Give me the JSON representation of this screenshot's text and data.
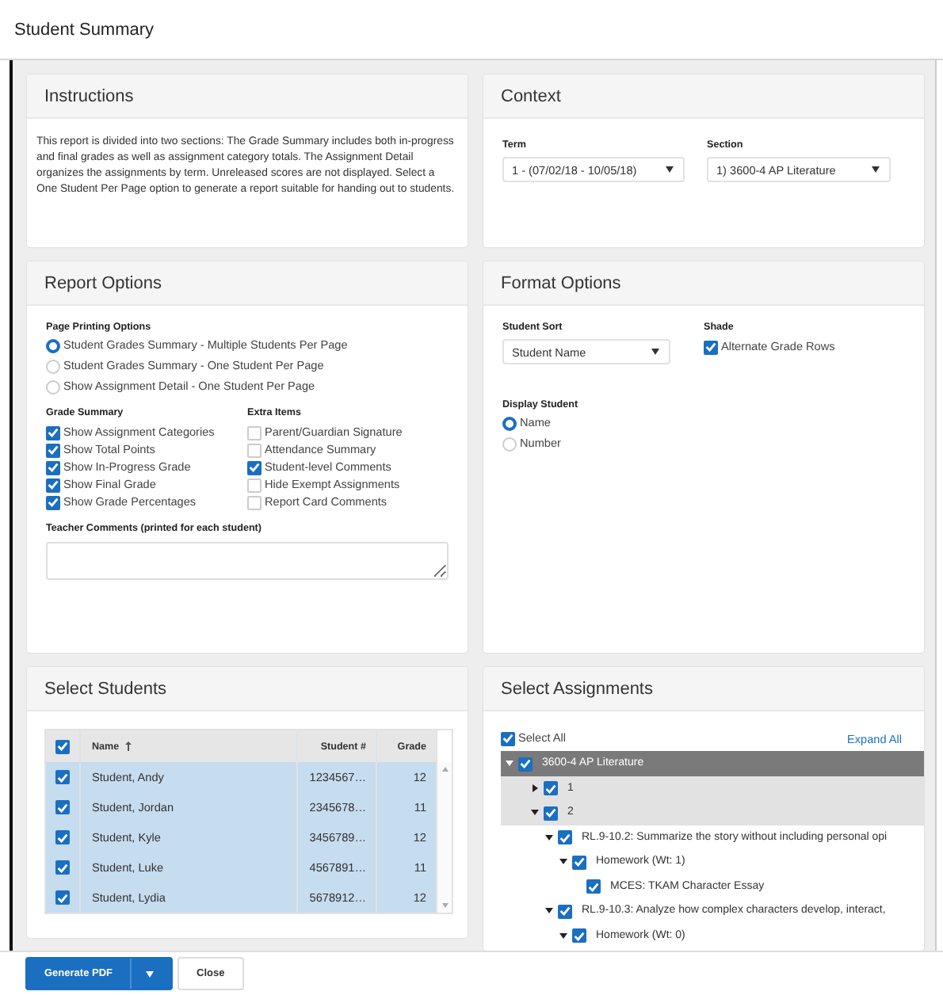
{
  "window": {
    "title": "Student Summary"
  },
  "instructions": {
    "title": "Instructions",
    "text": "This report is divided into two sections: The Grade Summary includes both in-progress and final grades as well as assignment category totals. The Assignment Detail organizes the assignments by term. Unreleased scores are not displayed. Select a One Student Per Page option to generate a report suitable for handing out to students."
  },
  "context": {
    "title": "Context",
    "fields": [
      {
        "label": "Term",
        "value": "1 - (07/02/18 - 10/05/18)"
      },
      {
        "label": "Section",
        "value": "1) 3600-4 AP Literature"
      }
    ]
  },
  "report_options": {
    "title": "Report Options",
    "page_printing": {
      "label": "Page Printing Options",
      "options": [
        {
          "label": "Student Grades Summary - Multiple Students Per Page",
          "selected": true
        },
        {
          "label": "Student Grades Summary - One Student Per Page",
          "selected": false
        },
        {
          "label": "Show Assignment Detail - One Student Per Page",
          "selected": false
        }
      ]
    },
    "grade_summary": {
      "label": "Grade Summary",
      "items": [
        {
          "label": "Show Assignment Categories",
          "checked": true
        },
        {
          "label": "Show Total Points",
          "checked": true
        },
        {
          "label": "Show In-Progress Grade",
          "checked": true
        },
        {
          "label": "Show Final Grade",
          "checked": true
        },
        {
          "label": "Show Grade Percentages",
          "checked": true
        }
      ]
    },
    "extra_items": {
      "label": "Extra Items",
      "items": [
        {
          "label": "Parent/Guardian Signature",
          "checked": false
        },
        {
          "label": "Attendance Summary",
          "checked": false
        },
        {
          "label": "Student-level Comments",
          "checked": true
        },
        {
          "label": "Hide Exempt Assignments",
          "checked": false
        },
        {
          "label": "Report Card Comments",
          "checked": false
        }
      ]
    },
    "teacher_comments": {
      "label": "Teacher Comments (printed for each student)"
    }
  },
  "format_options": {
    "title": "Format Options",
    "student_sort": {
      "label": "Student Sort",
      "value": "Student Name"
    },
    "shade": {
      "label": "Shade",
      "option": {
        "label": "Alternate Grade Rows",
        "checked": true
      }
    },
    "display_student": {
      "label": "Display Student",
      "options": [
        {
          "label": "Name",
          "selected": true
        },
        {
          "label": "Number",
          "selected": false
        }
      ]
    }
  },
  "select_students": {
    "title": "Select Students",
    "all_checked": true,
    "columns": [
      "Name",
      "Student #",
      "Grade"
    ],
    "rows": [
      {
        "name": "Student, Andy",
        "number": "1234567…",
        "grade": "12",
        "checked": true
      },
      {
        "name": "Student, Jordan",
        "number": "2345678…",
        "grade": "11",
        "checked": true
      },
      {
        "name": "Student, Kyle",
        "number": "3456789…",
        "grade": "12",
        "checked": true
      },
      {
        "name": "Student, Luke",
        "number": "4567891…",
        "grade": "11",
        "checked": true
      },
      {
        "name": "Student, Lydia",
        "number": "5678912…",
        "grade": "12",
        "checked": true
      }
    ]
  },
  "select_assignments": {
    "title": "Select Assignments",
    "select_all": {
      "label": "Select All",
      "checked": true
    },
    "expand_all": "Expand All",
    "tree": [
      {
        "label": "3600-4 AP Literature",
        "checked": true,
        "expanded": true,
        "children": [
          {
            "label": "1",
            "checked": true,
            "expanded": false
          },
          {
            "label": "2",
            "checked": true,
            "expanded": true,
            "children": [
              {
                "label": "RL.9-10.2: Summarize the story without including personal opi",
                "checked": true,
                "expanded": true,
                "children": [
                  {
                    "label": "Homework (Wt: 1)",
                    "checked": true,
                    "expanded": true,
                    "children": [
                      {
                        "label": "MCES: TKAM Character Essay",
                        "checked": true
                      }
                    ]
                  }
                ]
              },
              {
                "label": "RL.9-10.3: Analyze how complex characters develop, interact,",
                "checked": true,
                "expanded": true,
                "children": [
                  {
                    "label": "Homework (Wt: 0)",
                    "checked": true,
                    "expanded": true
                  }
                ]
              }
            ]
          }
        ]
      }
    ]
  },
  "footer": {
    "buttons": [
      {
        "label": "Generate PDF",
        "kind": "primary"
      },
      {
        "label": "Close",
        "kind": "secondary"
      }
    ]
  }
}
